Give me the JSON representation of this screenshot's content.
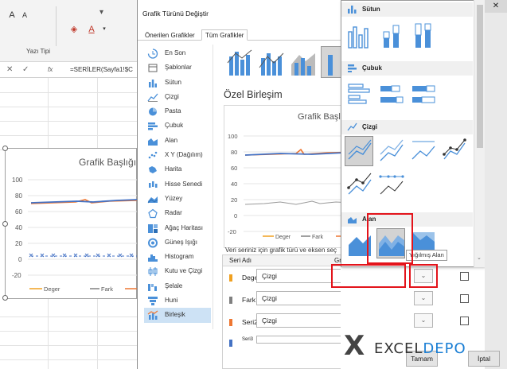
{
  "excel": {
    "font_group_label": "Yazı Tipi",
    "formula": "=SERİLER(Sayfa1!$C",
    "fx_label": "fx",
    "chart": {
      "title": "Grafik Başlığı",
      "y_ticks": [
        "100",
        "80",
        "60",
        "40",
        "20",
        "0",
        "-20"
      ],
      "legend": [
        "Deger",
        "Fark"
      ]
    }
  },
  "dialog": {
    "title": "Grafik Türünü Değiştir",
    "tabs": [
      "Önerilen Grafikler",
      "Tüm Grafikler"
    ],
    "nav": [
      {
        "label": "En Son",
        "icon": "recent-icon"
      },
      {
        "label": "Şablonlar",
        "icon": "templates-icon"
      },
      {
        "label": "Sütun",
        "icon": "column-chart-icon"
      },
      {
        "label": "Çizgi",
        "icon": "line-chart-icon"
      },
      {
        "label": "Pasta",
        "icon": "pie-chart-icon"
      },
      {
        "label": "Çubuk",
        "icon": "bar-chart-icon"
      },
      {
        "label": "Alan",
        "icon": "area-chart-icon"
      },
      {
        "label": "X Y (Dağılım)",
        "icon": "scatter-chart-icon"
      },
      {
        "label": "Harita",
        "icon": "map-chart-icon"
      },
      {
        "label": "Hisse Senedi",
        "icon": "stock-chart-icon"
      },
      {
        "label": "Yüzey",
        "icon": "surface-chart-icon"
      },
      {
        "label": "Radar",
        "icon": "radar-chart-icon"
      },
      {
        "label": "Ağaç Haritası",
        "icon": "treemap-chart-icon"
      },
      {
        "label": "Güneş Işığı",
        "icon": "sunburst-chart-icon"
      },
      {
        "label": "Histogram",
        "icon": "histogram-chart-icon"
      },
      {
        "label": "Kutu ve Çizgi",
        "icon": "box-whisker-chart-icon"
      },
      {
        "label": "Şelale",
        "icon": "waterfall-chart-icon"
      },
      {
        "label": "Huni",
        "icon": "funnel-chart-icon"
      },
      {
        "label": "Birleşik",
        "icon": "combo-chart-icon"
      }
    ],
    "selected_nav": "Birleşik",
    "section_title": "Özel Birleşim",
    "preview": {
      "title": "Grafik Başlı",
      "y_ticks": [
        "100",
        "80",
        "60",
        "40",
        "20",
        "0",
        "-20"
      ],
      "legend": [
        "Deger",
        "Fark"
      ]
    },
    "series_prompt": "Veri seriniz için grafik türü ve eksen seç",
    "table_headers": [
      "Seri Adı",
      "Gra"
    ],
    "series": [
      {
        "name": "Deger",
        "type": "Çizgi",
        "color": "#f0a020"
      },
      {
        "name": "Fark",
        "type": "Çizgi",
        "color": "#808080"
      },
      {
        "name": "Seri2",
        "type": "Çizgi",
        "color": "#ee7732"
      },
      {
        "name": "Seri3",
        "type": "",
        "color": "#4472c4"
      }
    ],
    "ok_label": "Tamam",
    "cancel_label": "İptal"
  },
  "dropdown": {
    "sections": [
      "Sütun",
      "Çubuk",
      "Çizgi",
      "Alan"
    ],
    "tooltip": "Yığılmış Alan"
  },
  "brand": {
    "mark": "X",
    "name_part1": "EXCEL",
    "name_part2": "DEPO"
  },
  "colors": {
    "accent_blue": "#4a90d9",
    "highlight_red": "#e3141b",
    "series_orange": "#ee7732",
    "series_blue": "#4472c4",
    "series_gray": "#808080",
    "series_yellow": "#f0a020"
  }
}
